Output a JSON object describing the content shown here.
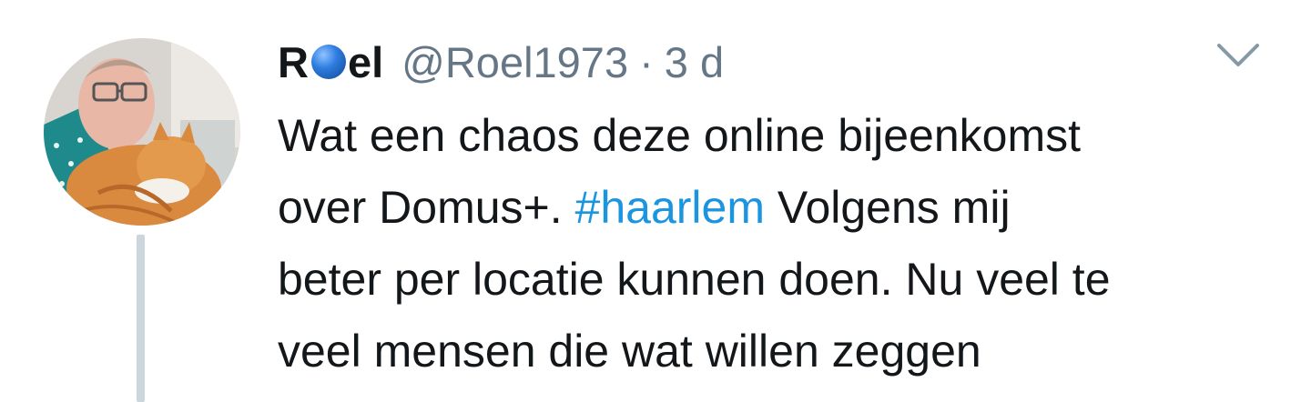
{
  "tweet": {
    "author": {
      "name_prefix": "R",
      "name_emoji": "blue-circle-emoji",
      "name_suffix": "el",
      "handle": "@Roel1973",
      "separator": "·",
      "time": "3 d",
      "avatar_icon": "profile-photo-man-with-cat"
    },
    "menu_icon": "chevron-down-icon",
    "text": {
      "line1": "Wat een chaos deze online bijeenkomst",
      "line2_before": "over Domus+. ",
      "hashtag": "#haarlem",
      "line2_after": " Volgens mij",
      "line3": "beter per locatie kunnen doen. Nu veel te",
      "line4": "veel mensen die wat willen zeggen"
    }
  },
  "colors": {
    "text": "#14171a",
    "secondary": "#657786",
    "hashtag": "#1b95e0",
    "thread_line": "#ccd6dd",
    "emoji_blue": "#2f7de1"
  }
}
